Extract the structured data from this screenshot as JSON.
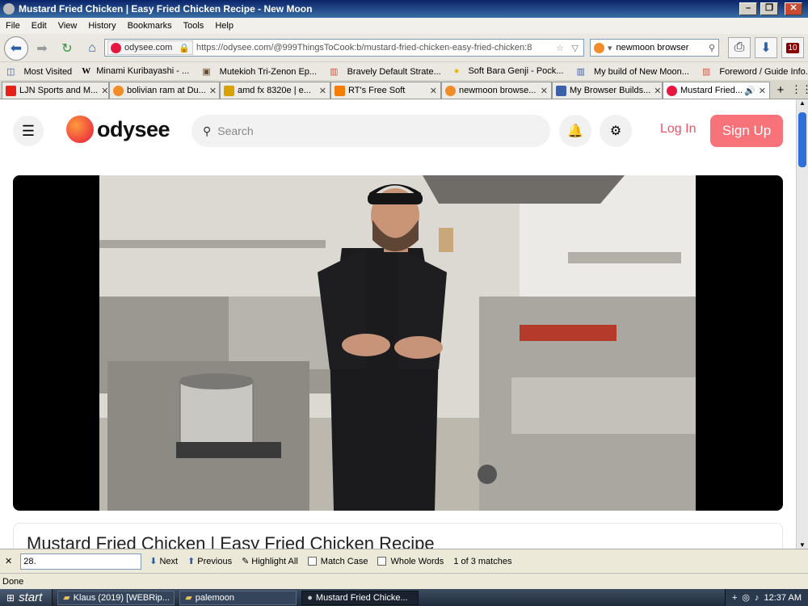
{
  "window": {
    "title": "Mustard Fried Chicken | Easy Fried Chicken Recipe - New Moon",
    "minimize": "–",
    "maximize": "❐",
    "close": "✕"
  },
  "menu": [
    "File",
    "Edit",
    "View",
    "History",
    "Bookmarks",
    "Tools",
    "Help"
  ],
  "nav": {
    "site_identity": "odysee.com",
    "url": "https://odysee.com/@999ThingsToCook:b/mustard-fried-chicken-easy-fried-chicken:8",
    "search_value": "newmoon browser",
    "download_badge": "10"
  },
  "bookmarks": [
    "Most Visited",
    "Minami Kuribayashi - ...",
    "Mutekioh Tri-Zenon Ep...",
    "Bravely Default Strate...",
    "Soft Bara Genji - Pock...",
    "My build of New Moon...",
    "Foreword / Guide Info..."
  ],
  "tabs": [
    {
      "label": "LJN Sports and M...",
      "color": "#e62117"
    },
    {
      "label": "bolivian ram at Du...",
      "color": "#f28c28"
    },
    {
      "label": "amd fx 8320e | e...",
      "color": "#d8a200"
    },
    {
      "label": "RT's Free Soft",
      "color": "#f57d00"
    },
    {
      "label": "newmoon browse...",
      "color": "#f28c28"
    },
    {
      "label": "My Browser Builds...",
      "color": "#3b62a8"
    },
    {
      "label": "Mustard Fried...",
      "color": "#e8173f"
    }
  ],
  "odysee": {
    "logo_text": "odysee",
    "search_placeholder": "Search",
    "login": "Log In",
    "signup": "Sign Up",
    "video_title": "Mustard Fried Chicken | Easy Fried Chicken Recipe"
  },
  "find": {
    "close": "✕",
    "query": "28.",
    "next": "Next",
    "previous": "Previous",
    "highlight_all": "Highlight All",
    "match_case": "Match Case",
    "whole_words": "Whole Words",
    "matches": "1 of 3 matches"
  },
  "status": "Done",
  "taskbar": {
    "start": "start",
    "tasks": [
      "Klaus (2019) [WEBRip...",
      "palemoon",
      "Mustard Fried Chicke..."
    ],
    "clock": "12:37 AM"
  },
  "colors": {
    "accent": "#e8173f",
    "signup_bg": "#f77379",
    "login_text": "#ea5466"
  }
}
